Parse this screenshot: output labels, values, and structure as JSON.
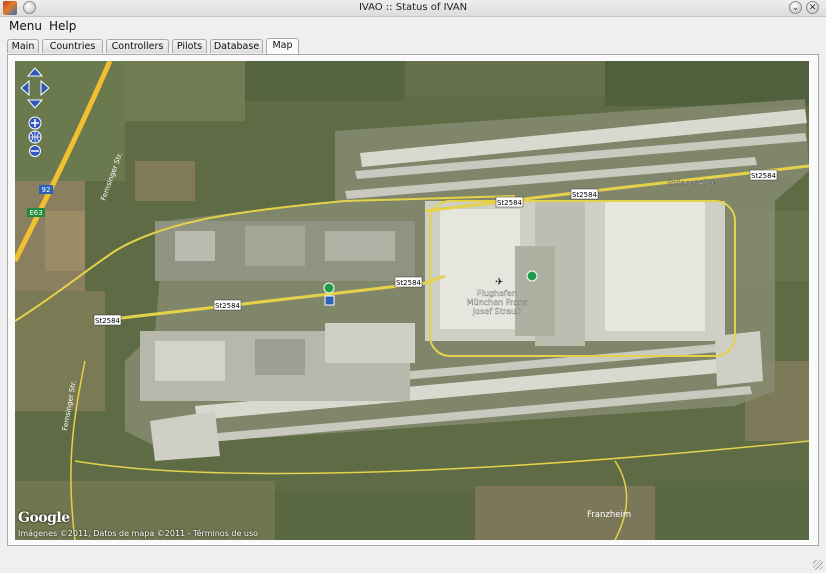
{
  "window": {
    "title": "IVAO :: Status of IVAN"
  },
  "menu": {
    "items": [
      "Menu",
      "Help"
    ]
  },
  "tabs": [
    "Main",
    "Countries",
    "Controllers",
    "Pilots",
    "Database",
    "Map"
  ],
  "active_tab": "Map",
  "map": {
    "roads": {
      "st2584_a": "St2584",
      "st2584_b": "St2584",
      "st2584_c": "St2584",
      "st2584_d": "St2584",
      "st2584_e": "St2584",
      "st2584_f": "St2584",
      "erdinger": "Erdinger Allee",
      "fernsinger_top": "Fernsinger Str.",
      "fernsinger_bottom": "Fernsinger Str.",
      "route_92": "92",
      "route_e63": "E63"
    },
    "airport_label": [
      "Flughafen",
      "München Franz",
      "Josef Strauß"
    ],
    "place_label": "Franzheim",
    "google_logo": "Google",
    "attribution": "Imágenes ©2011, Datos de mapa ©2011 - Términos de uso",
    "colors": {
      "terrain": "#5e6b45",
      "runway": "#d9d9d0",
      "road": "#e4d24a",
      "highway": "#f0c030"
    }
  }
}
